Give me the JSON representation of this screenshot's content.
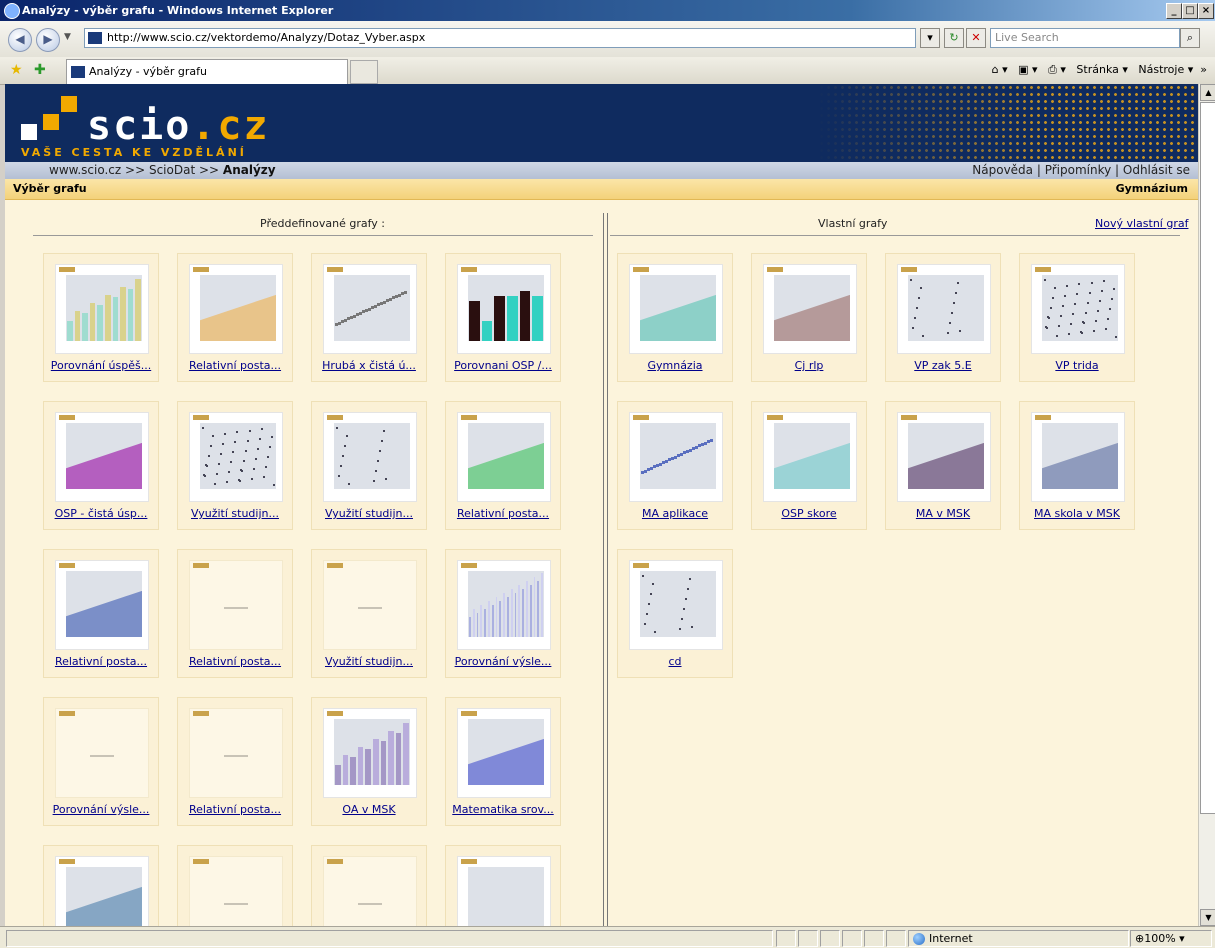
{
  "window": {
    "title": "Analýzy - výběr grafu - Windows Internet Explorer",
    "minimize": "_",
    "maximize": "□",
    "close": "×"
  },
  "browser": {
    "url": "http://www.scio.cz/vektordemo/Analyzy/Dotaz_Vyber.aspx",
    "search_placeholder": "Live Search",
    "tab_title": "Analýzy - výběr grafu",
    "toolbar_page": "Stránka",
    "toolbar_tools": "Nástroje",
    "zoom": "100%",
    "zone": "Internet"
  },
  "site": {
    "logo": "scio",
    "logo_tld": ".cz",
    "tagline": "VAŠE CESTA KE VZDĚLÁNÍ",
    "breadcrumb": [
      {
        "label": "www.scio.cz",
        "sep": ">>"
      },
      {
        "label": "ScioDat",
        "sep": ">>"
      },
      {
        "label": "Analýzy",
        "sep": ""
      }
    ],
    "top_links": [
      "Nápověda",
      "Připomínky",
      "Odhlásit se"
    ],
    "section_title": "Výběr grafu",
    "school_type": "Gymnázium"
  },
  "predefined": {
    "heading": "Předdefinované grafy :",
    "items": [
      {
        "label": "Porovnání úspěš...",
        "kind": "bars-green"
      },
      {
        "label": "Relativní posta...",
        "kind": "area-orange"
      },
      {
        "label": "Hrubá x čistá ú...",
        "kind": "line-gray"
      },
      {
        "label": "Porovnani OSP /...",
        "kind": "bars-dark"
      },
      {
        "label": "OSP - čistá úsp...",
        "kind": "area-purple"
      },
      {
        "label": "Využití studijn...",
        "kind": "scatter"
      },
      {
        "label": "Využití studijn...",
        "kind": "scatter-sparse"
      },
      {
        "label": "Relativní posta...",
        "kind": "area-green"
      },
      {
        "label": "Relativní posta...",
        "kind": "area-blue"
      },
      {
        "label": "Relativní posta...",
        "kind": "blank"
      },
      {
        "label": "Využití studijn...",
        "kind": "blank"
      },
      {
        "label": "Porovnání výsle...",
        "kind": "bars-lavender"
      },
      {
        "label": "Porovnání výsle...",
        "kind": "blank"
      },
      {
        "label": "Relativní posta...",
        "kind": "blank"
      },
      {
        "label": "OA v MSK",
        "kind": "bars-purple-step"
      },
      {
        "label": "Matematika srov...",
        "kind": "area-periwinkle"
      },
      {
        "label": "",
        "kind": "area-steel"
      },
      {
        "label": "",
        "kind": "blank"
      },
      {
        "label": "",
        "kind": "blank"
      },
      {
        "label": "",
        "kind": "plot-gray"
      }
    ]
  },
  "custom": {
    "heading": "Vlastní grafy",
    "new_link": "Nový vlastní graf",
    "items": [
      {
        "label": "Gymnázia",
        "kind": "area-teal"
      },
      {
        "label": "Cj rlp",
        "kind": "area-mauve"
      },
      {
        "label": "VP zak 5.E",
        "kind": "scatter-sparse"
      },
      {
        "label": "VP trida",
        "kind": "scatter"
      },
      {
        "label": "MA aplikace",
        "kind": "line-blue"
      },
      {
        "label": "OSP skore",
        "kind": "area-teal-light"
      },
      {
        "label": "MA v MSK",
        "kind": "area-dark-purple"
      },
      {
        "label": "MA skola v MSK",
        "kind": "area-slate"
      },
      {
        "label": "cd",
        "kind": "scatter-sparse"
      }
    ]
  }
}
